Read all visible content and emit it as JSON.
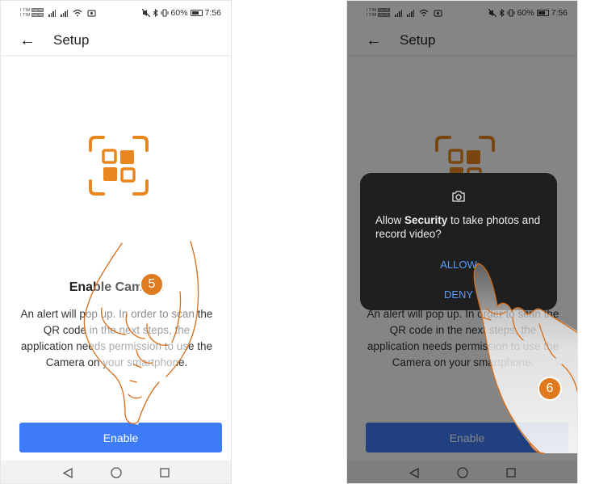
{
  "colors": {
    "accent_orange": "#e8861f",
    "primary_blue": "#3e7bf6",
    "dialog_bg": "#1f1f1f",
    "dialog_button": "#5b9cf8",
    "step_badge": "#e07a1f"
  },
  "status_bar": {
    "carrier_1": "I TIM",
    "carrier_2": "I TIM",
    "volte": "VoLTE",
    "battery": "60%",
    "time": "7:56"
  },
  "app_bar": {
    "back_icon": "arrow-left-icon",
    "title": "Setup"
  },
  "main": {
    "qr_icon": "qr-scan-icon",
    "title": "Enable Camera",
    "description": "An alert will pop up. In order to scan the QR code in the next steps, the application needs permission to use the Camera on your smartphone.",
    "enable_button": "Enable"
  },
  "nav_bar": {
    "back": "triangle-back-icon",
    "home": "circle-home-icon",
    "recent": "square-recent-icon"
  },
  "dialog": {
    "icon": "camera-icon",
    "text_prefix": "Allow ",
    "app_name": "Security",
    "text_suffix": " to take photos and record video?",
    "allow": "ALLOW",
    "deny": "DENY"
  },
  "steps": {
    "step_1": "5",
    "step_2": "6"
  }
}
